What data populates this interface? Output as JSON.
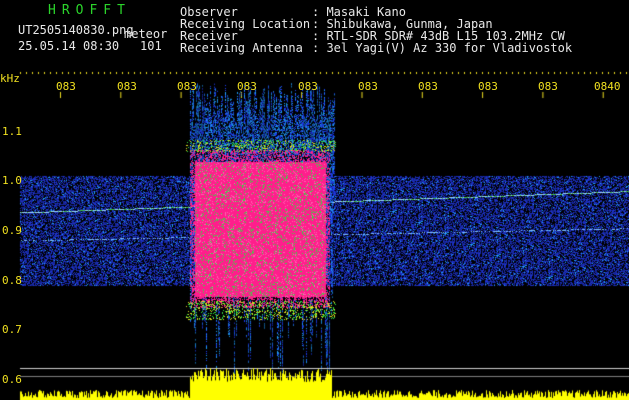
{
  "header": {
    "brand": "HROFFT",
    "filename": "UT2505140830.png",
    "mode": "meteor",
    "datetime": "25.05.14 08:30",
    "count": "101",
    "fields": [
      {
        "label": "Observer",
        "value": ": Masaki Kano"
      },
      {
        "label": "Receiving Location",
        "value": ": Shibukawa, Gunma, Japan"
      },
      {
        "label": "Receiver",
        "value": ": RTL-SDR SDR# 43dB L15 103.2MHz CW"
      },
      {
        "label": "Receiving Antenna",
        "value": ": 3el Yagi(V) Az 330 for Vladivostok"
      }
    ]
  },
  "axis": {
    "y_unit": "kHz",
    "y_ticks": [
      "1.1",
      "1.0",
      "0.9",
      "0.8",
      "0.7",
      "0.6"
    ],
    "x_ticks": [
      "083",
      "083",
      "083",
      "083",
      "083",
      "083",
      "083",
      "083",
      "083",
      "0840"
    ]
  },
  "colors": {
    "background": "#000000",
    "signal_hot": "#ff1e8c",
    "signal_warm": "#30e040",
    "noise": "#1c2fc8",
    "amplitude": "#ffff00"
  }
}
